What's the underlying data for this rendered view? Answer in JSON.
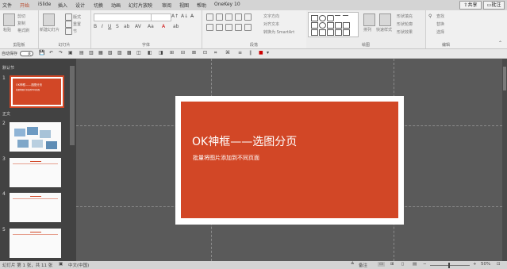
{
  "tabs": [
    "文件",
    "开始",
    "iSlide",
    "插入",
    "设计",
    "切换",
    "动画",
    "幻灯片放映",
    "审阅",
    "视图",
    "帮助",
    "OneKey 10"
  ],
  "active_tab": "开始",
  "share_label": "共享",
  "comment_label": "批注",
  "ribbon": {
    "clipboard": {
      "paste": "粘贴",
      "cut": "剪切",
      "copy": "复制",
      "format": "格式刷",
      "label": "剪贴板"
    },
    "slides": {
      "new": "新建幻灯片",
      "layout": "版式",
      "reset": "重置",
      "section": "节",
      "label": "幻灯片"
    },
    "font": {
      "label": "字体"
    },
    "paragraph": {
      "direction": "文字方向",
      "align": "对齐文本",
      "smartart": "转换为 SmartArt",
      "label": "段落"
    },
    "drawing": {
      "arrange": "排列",
      "styles": "快速样式",
      "fill": "形状填充",
      "outline": "形状轮廓",
      "effect": "形状效果",
      "label": "绘图"
    },
    "editing": {
      "find": "查找",
      "replace": "替换",
      "select": "选择",
      "label": "编辑"
    }
  },
  "qat": {
    "autosave": "自动保存",
    "toggle": "关"
  },
  "thumbnails": {
    "section1": "默认节",
    "section2": "正文",
    "slides": [
      {
        "num": "1"
      },
      {
        "num": "2"
      },
      {
        "num": "3"
      },
      {
        "num": "4"
      },
      {
        "num": "5"
      }
    ],
    "thumb_title": "OK神框——选图分页",
    "thumb_sub": "批量将图片添加到不同页面"
  },
  "slide": {
    "title": "OK神框——选图分页",
    "subtitle": "批量将图片添加到不同页面"
  },
  "status": {
    "slide_count": "幻灯片 第 1 张，共 11 张",
    "language": "中文(中国)",
    "notes": "备注",
    "zoom": "50%"
  },
  "colors": {
    "accent": "#d24726",
    "tab_active": "#b7472a"
  }
}
